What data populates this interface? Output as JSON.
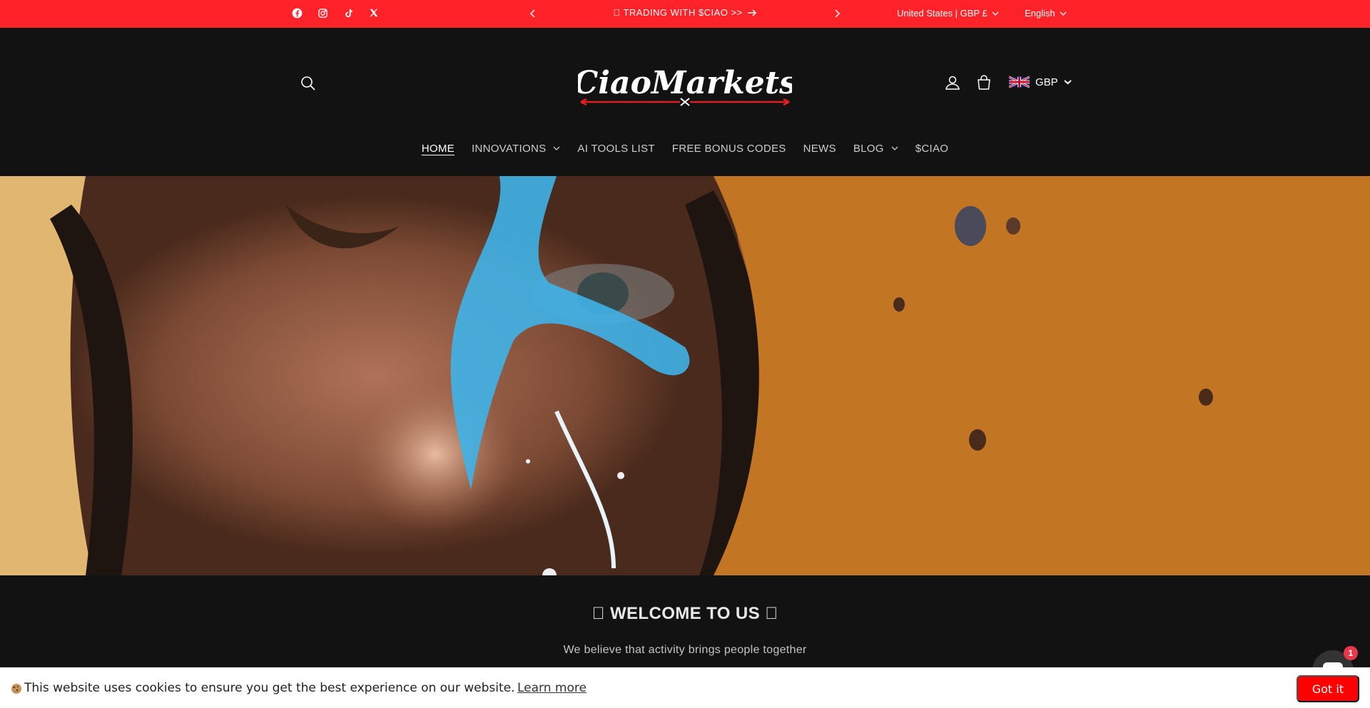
{
  "announcement": {
    "message": "\u0000 TRADING WITH $CIAO >>",
    "country_selector": "United States | GBP £",
    "language_selector": "English",
    "social": [
      "facebook-icon",
      "instagram-icon",
      "tiktok-icon",
      "x-icon"
    ],
    "bar_color": "#ff2329"
  },
  "header": {
    "logo_text": "CiaoMarkets",
    "currency": "GBP",
    "icons": [
      "search-icon",
      "account-icon",
      "cart-icon",
      "uk-flag-icon"
    ]
  },
  "nav": {
    "items": [
      {
        "label": "HOME",
        "active": true,
        "dropdown": false
      },
      {
        "label": "INNOVATIONS",
        "active": false,
        "dropdown": true
      },
      {
        "label": "AI TOOLS LIST",
        "active": false,
        "dropdown": false
      },
      {
        "label": "FREE BONUS CODES",
        "active": false,
        "dropdown": false
      },
      {
        "label": "NEWS",
        "active": false,
        "dropdown": false
      },
      {
        "label": "BLOG",
        "active": false,
        "dropdown": true
      },
      {
        "label": "$CIAO",
        "active": false,
        "dropdown": false
      }
    ]
  },
  "welcome": {
    "title": "\u0000 WELCOME TO US \u0000",
    "subtitle": "We believe that activity brings people together"
  },
  "chat": {
    "badge": "1"
  },
  "cookie": {
    "text": "This website uses cookies to ensure you get the best experience on our website.",
    "link": "Learn more",
    "button": "Got it",
    "button_color": "#ff0000"
  }
}
